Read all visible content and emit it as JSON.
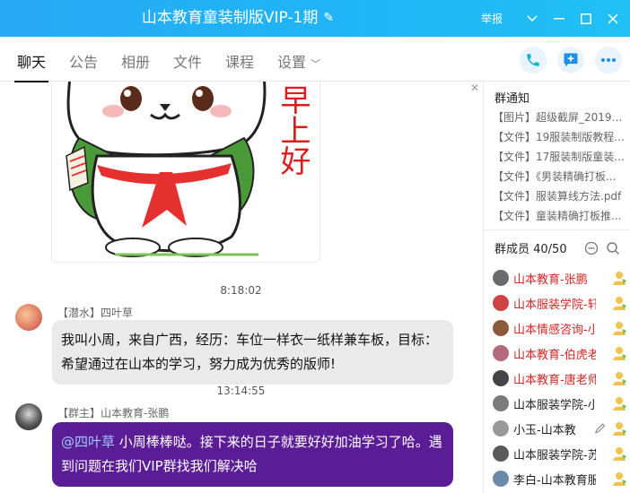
{
  "window": {
    "title": "山本教育童装制版VIP-1期",
    "report_label": "举报"
  },
  "tabs": [
    {
      "label": "聊天",
      "active": true
    },
    {
      "label": "公告"
    },
    {
      "label": "相册"
    },
    {
      "label": "文件"
    },
    {
      "label": "课程"
    },
    {
      "label": "设置"
    }
  ],
  "colors": {
    "accent": "#1fb4f6",
    "mine_bubble": "#5b1d96",
    "admin_name": "#d32525"
  },
  "sticker_text": "早上好",
  "messages": [
    {
      "time": "8:18:02"
    },
    {
      "sender": "【潜水】四叶草",
      "text": "我叫小周，来自广西，经历：车位一样衣一纸样兼车板，目标：希望通过在山本的学习，努力成为优秀的版师!"
    },
    {
      "time": "13:14:55"
    },
    {
      "sender": "【群主】山本教育-张鹏",
      "mention": "@四叶草",
      "text": " 小周棒棒哒。接下来的日子就要好好加油学习了哈。遇到问题在我们VIP群找我们解决哈"
    }
  ],
  "side": {
    "notice_title": "群通知",
    "notices": [
      "【图片】超级截屏_20190...",
      "【文件】19服装制版教程...",
      "【文件】17服装制版童装...",
      "【文件】《男装精确打板...",
      "【文件】服装算线方法.pdf",
      "【文件】童装精确打板推..."
    ],
    "members_title": "群成员 40/50",
    "members": [
      {
        "name": "山本教育-张鹏",
        "red": true
      },
      {
        "name": "山本服装学院-轩",
        "red": true
      },
      {
        "name": "山本情感咨询-小",
        "red": true
      },
      {
        "name": "山本教育-伯虎老",
        "red": true
      },
      {
        "name": "山本教育-唐老师",
        "red": true
      },
      {
        "name": "山本服装学院-小",
        "red": false
      },
      {
        "name": "小玉-山本教",
        "red": false
      },
      {
        "name": "山本服装学院-苏",
        "red": false
      },
      {
        "name": "李白-山本教育服",
        "red": false
      }
    ]
  }
}
